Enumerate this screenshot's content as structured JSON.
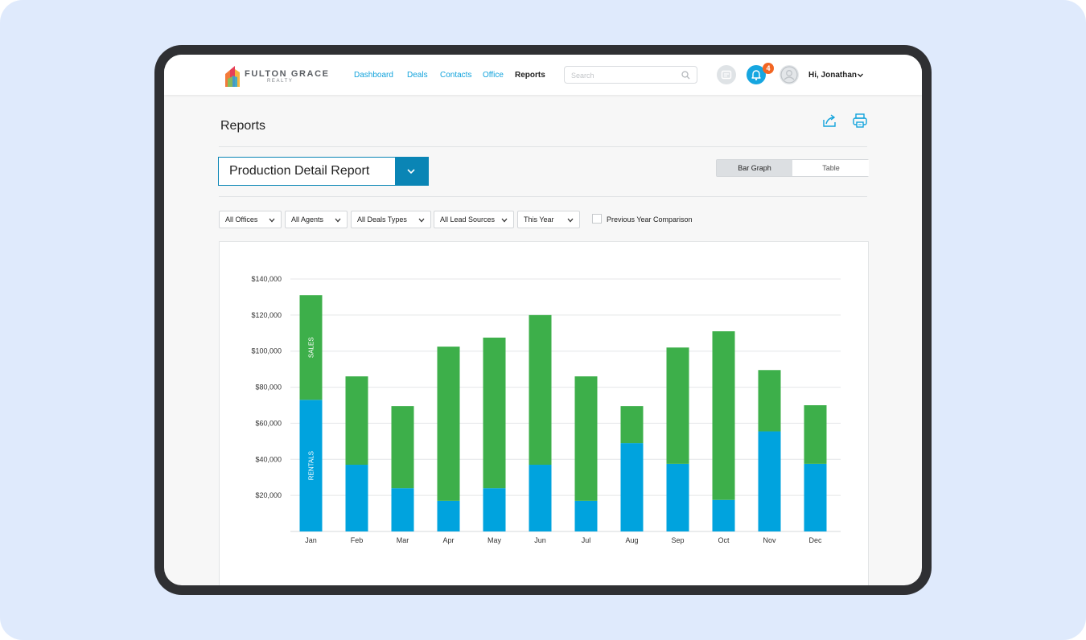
{
  "brand": {
    "name": "FULTON GRACE",
    "sub": "REALTY"
  },
  "nav": {
    "items": [
      {
        "label": "Dashboard",
        "active": false
      },
      {
        "label": "Deals",
        "active": false
      },
      {
        "label": "Contacts",
        "active": false
      },
      {
        "label": "Office",
        "active": false
      },
      {
        "label": "Reports",
        "active": true
      }
    ]
  },
  "search": {
    "placeholder": "Search",
    "value": ""
  },
  "notifications": {
    "count": "4"
  },
  "user": {
    "greeting": "Hi, Jonathan"
  },
  "page": {
    "title": "Reports"
  },
  "report_selector": {
    "selected": "Production Detail Report"
  },
  "view_toggle": {
    "options": [
      "Bar Graph",
      "Table"
    ],
    "selected": "Bar Graph"
  },
  "filters": {
    "offices": "All Offices",
    "agents": "All Agents",
    "deal_types": "All Deals Types",
    "lead_sources": "All Lead Sources",
    "period": "This Year",
    "comparison_label": "Previous Year Comparison",
    "comparison_checked": false
  },
  "colors": {
    "accent": "#12a3dc",
    "select_blue": "#0a85b5",
    "rentals": "#00a3de",
    "sales": "#3daf4a",
    "badge": "#f26522"
  },
  "chart_data": {
    "type": "bar",
    "stacked": true,
    "categories": [
      "Jan",
      "Feb",
      "Mar",
      "Apr",
      "May",
      "Jun",
      "Jul",
      "Aug",
      "Sep",
      "Oct",
      "Nov",
      "Dec"
    ],
    "series": [
      {
        "name": "RENTALS",
        "color": "#00a3de",
        "values": [
          73000,
          37000,
          24000,
          17000,
          24000,
          37000,
          17000,
          49000,
          37500,
          17500,
          55500,
          37500
        ]
      },
      {
        "name": "SALES",
        "color": "#3daf4a",
        "values": [
          58000,
          49000,
          45500,
          85500,
          83500,
          83000,
          69000,
          20500,
          64500,
          93500,
          34000,
          32500
        ]
      }
    ],
    "ylim": [
      0,
      140000
    ],
    "yticks": [
      20000,
      40000,
      60000,
      80000,
      100000,
      120000,
      140000
    ],
    "ytick_labels": [
      "$20,000",
      "$40,000",
      "$60,000",
      "$80,000",
      "$100,000",
      "$120,000",
      "$140,000"
    ],
    "grid": true,
    "legend": "labels inside first bar",
    "title": "",
    "xlabel": "",
    "ylabel": ""
  }
}
